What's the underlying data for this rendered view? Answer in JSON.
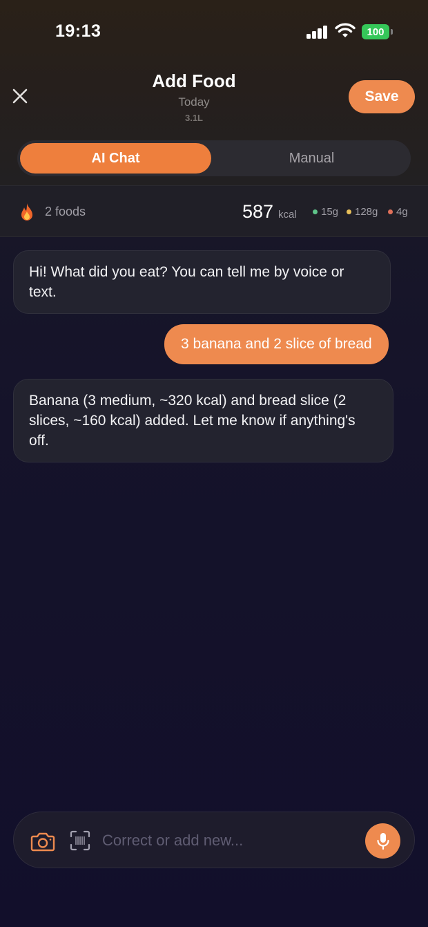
{
  "status_bar": {
    "time": "19:13",
    "battery": "100"
  },
  "header": {
    "title": "Add Food",
    "subtitle": "Today",
    "water": "3.1L",
    "save_label": "Save"
  },
  "tabs": [
    {
      "label": "AI Chat",
      "active": true
    },
    {
      "label": "Manual",
      "active": false
    }
  ],
  "summary": {
    "foods": "2 foods",
    "kcal": "587",
    "kcal_unit": "kcal",
    "macros": [
      {
        "value": "15g",
        "color": "#5fc48a"
      },
      {
        "value": "128g",
        "color": "#e8c05a"
      },
      {
        "value": "4g",
        "color": "#e0705a"
      }
    ]
  },
  "messages": [
    {
      "role": "assistant",
      "text": "Hi! What did you eat? You can tell me by voice or text."
    },
    {
      "role": "user",
      "text": "3 banana and 2 slice of bread"
    },
    {
      "role": "assistant",
      "text": "Banana (3 medium, ~320 kcal) and bread slice (2 slices, ~160 kcal) added. Let me know if anything's off."
    }
  ],
  "input": {
    "placeholder": "Correct or add new...",
    "value": ""
  },
  "colors": {
    "accent": "#ee8a4f",
    "tab_active": "#ee7f3d"
  }
}
